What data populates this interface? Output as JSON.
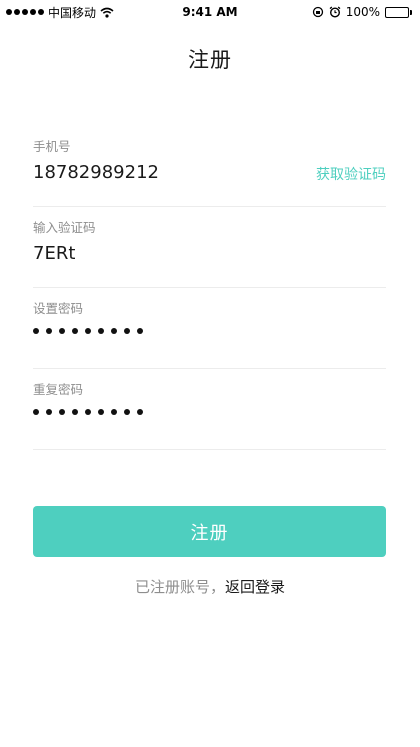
{
  "status_bar": {
    "carrier": "中国移动",
    "time": "9:41 AM",
    "battery": "100%",
    "icons": [
      "signal-icon",
      "wifi-icon",
      "rotation-lock-icon",
      "alarm-icon",
      "battery-icon"
    ]
  },
  "nav": {
    "title": "注册"
  },
  "form": {
    "phone": {
      "label": "手机号",
      "value": "18782989212",
      "action": "获取验证码"
    },
    "code": {
      "label": "输入验证码",
      "value": "7ERt"
    },
    "password": {
      "label": "设置密码",
      "masked_length": 9
    },
    "confirm_password": {
      "label": "重复密码",
      "masked_length": 9
    }
  },
  "submit": {
    "label": "注册"
  },
  "footer": {
    "prompt": "已注册账号，",
    "link": "返回登录"
  },
  "colors": {
    "accent": "#4ecfbf",
    "text": "#1a1a1a",
    "muted": "#8e8e8e",
    "divider": "#ececec"
  }
}
